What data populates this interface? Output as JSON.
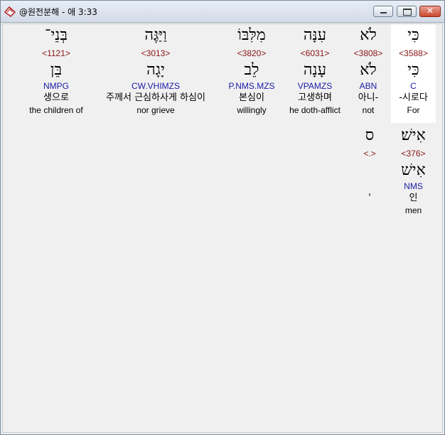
{
  "window": {
    "title": "@원전분해 - 애 3:33"
  },
  "row1": [
    {
      "hebrew": "כִּי",
      "strong": "<3588>",
      "hebrew2": "כִּי",
      "morph": "C",
      "korean": "-시로다",
      "english": "For"
    },
    {
      "hebrew": "לֹא",
      "strong": "<3808>",
      "hebrew2": "לֹא",
      "morph": "ABN",
      "korean": "아니-",
      "english": "not"
    },
    {
      "hebrew": "עִנָּה",
      "strong": "<6031>",
      "hebrew2": "עָנָה",
      "morph": "VPAMZS",
      "korean": "고생하며",
      "english": "he doth-afflict"
    },
    {
      "hebrew": "מִלִּבּוֹ",
      "strong": "<3820>",
      "hebrew2": "לֵב",
      "morph": "P.NMS.MZS",
      "korean": "본심이",
      "english": "willingly"
    },
    {
      "hebrew": "וַיַּגֶּה",
      "strong": "<3013>",
      "hebrew2": "יָגָה",
      "morph": "CW.VHIMZS",
      "korean": "주께서 근심하사게 하심이",
      "english": "nor grieve"
    },
    {
      "hebrew": "בְּנֵי־",
      "strong": "<1121>",
      "hebrew2": "בֵּן",
      "morph": "NMPG",
      "korean": "생으로",
      "english": "the children of"
    }
  ],
  "row2": [
    {
      "hebrew": "אִישׁ׃",
      "strong": "<376>",
      "hebrew2": "אִישׁ",
      "morph": "NMS",
      "korean": "인",
      "english": "men"
    },
    {
      "hebrew": "ס",
      "strong": "<.>",
      "hebrew2": "",
      "morph": "",
      "korean": "'",
      "english": ""
    }
  ]
}
